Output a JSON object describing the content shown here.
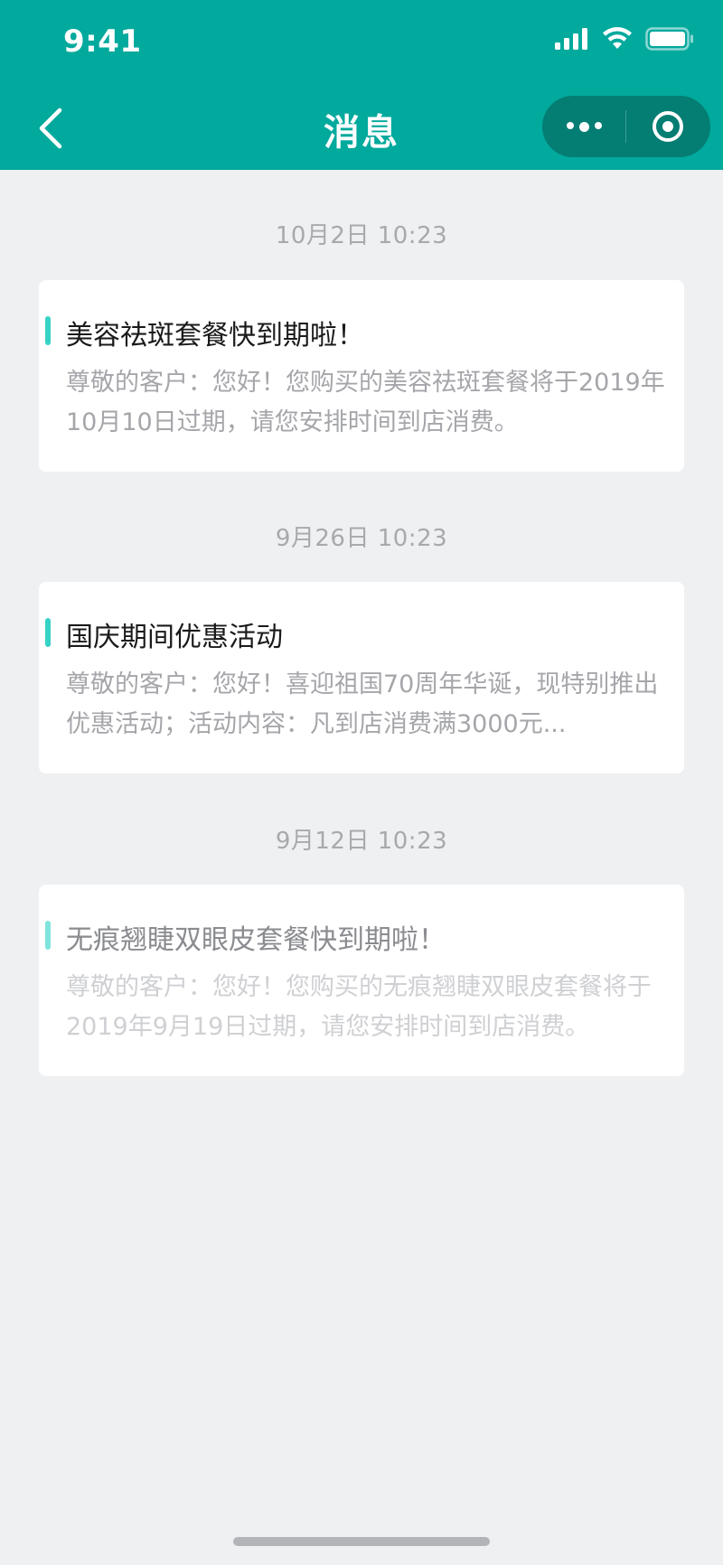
{
  "status_bar": {
    "time": "9:41"
  },
  "nav": {
    "title": "消息"
  },
  "messages": [
    {
      "time": "10月2日  10:23",
      "title": "美容祛斑套餐快到期啦！",
      "body": "尊敬的客户：您好！您购买的美容祛斑套餐将于2019年10月10日过期，请您安排时间到店消费。",
      "read": false
    },
    {
      "time": "9月26日  10:23",
      "title": "国庆期间优惠活动",
      "body": "尊敬的客户：您好！喜迎祖国70周年华诞，现特别推出优惠活动；活动内容：凡到店消费满3000元...",
      "read": false
    },
    {
      "time": "9月12日  10:23",
      "title": "无痕翘睫双眼皮套餐快到期啦！",
      "body": "尊敬的客户：您好！您购买的无痕翘睫双眼皮套餐将于2019年9月19日过期，请您安排时间到店消费。",
      "read": true
    }
  ],
  "colors": {
    "header": "#02a99d",
    "accent_bar": "#35d2c6",
    "background": "#eff0f2"
  }
}
